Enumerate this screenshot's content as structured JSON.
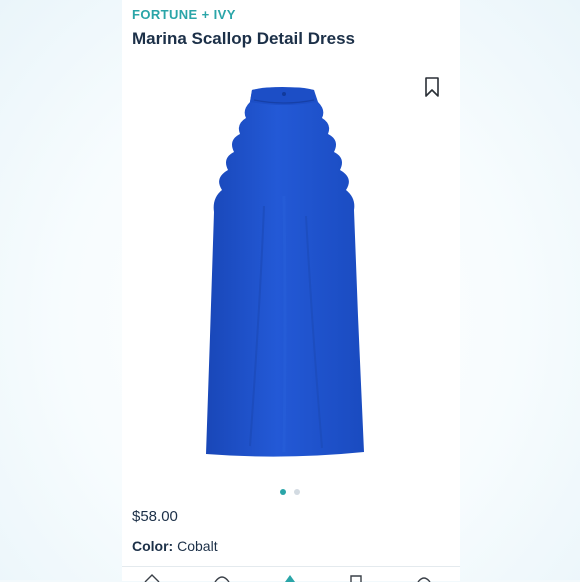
{
  "product": {
    "brand": "FORTUNE + IVY",
    "name": "Marina Scallop Detail Dress",
    "price": "$58.00",
    "color_label": "Color:",
    "color_value": "Cobalt"
  },
  "carousel": {
    "image_count": 2,
    "active_index": 0
  },
  "icons": {
    "bookmark": "bookmark-icon",
    "nav": [
      "home-icon",
      "styles-icon",
      "fix-icon",
      "bag-icon",
      "account-icon"
    ]
  },
  "colors": {
    "accent": "#2aa5a8",
    "text": "#1c3048",
    "dress": "#1f52cc",
    "background": "#f2f9fc"
  }
}
